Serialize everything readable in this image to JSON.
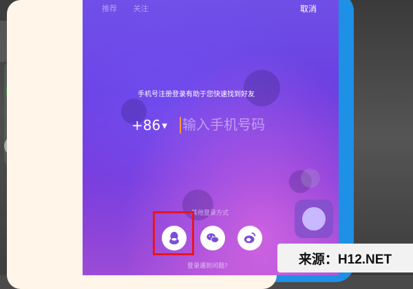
{
  "header": {
    "tabs": [
      "推荐",
      "关注"
    ],
    "cancel_label": "取消"
  },
  "login": {
    "hint": "手机号注册登录有助于您快速找到好友",
    "country_code": "+86",
    "phone_placeholder": "输入手机号码",
    "more_methods_label": "其他登录方式",
    "trouble_label": "登录遇到问题?"
  },
  "social_icons": [
    "qq-icon",
    "wechat-icon",
    "weibo-icon"
  ],
  "colors": {
    "highlight": "#e8151f",
    "cursor": "#ff9a2a",
    "frame": "#1e90e6"
  },
  "watermark": {
    "text": "来源：H12.NET"
  }
}
